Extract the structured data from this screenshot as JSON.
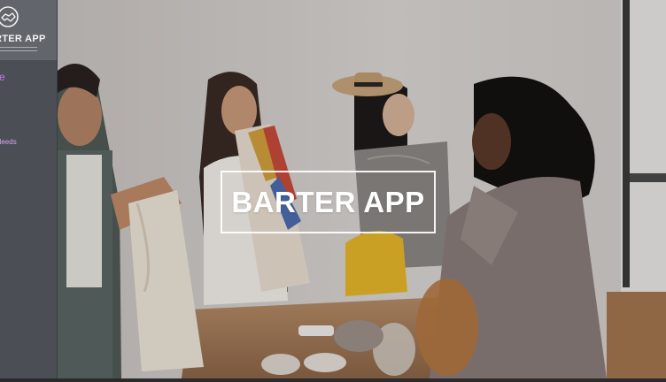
{
  "brand": {
    "name": "RTER APP",
    "logo_icon": "handshake-icon"
  },
  "sidebar": {
    "items": [
      {
        "label": "e"
      },
      {
        "label": ""
      },
      {
        "label": "and Needs"
      },
      {
        "label": ""
      },
      {
        "label": ""
      }
    ]
  },
  "hero": {
    "title": "BARTER APP",
    "image": "photo-people-exchanging-items"
  },
  "colors": {
    "sidebar_bg": "#4b4f55",
    "brand_bg": "#62666c",
    "nav_accent": "#c779f3"
  }
}
